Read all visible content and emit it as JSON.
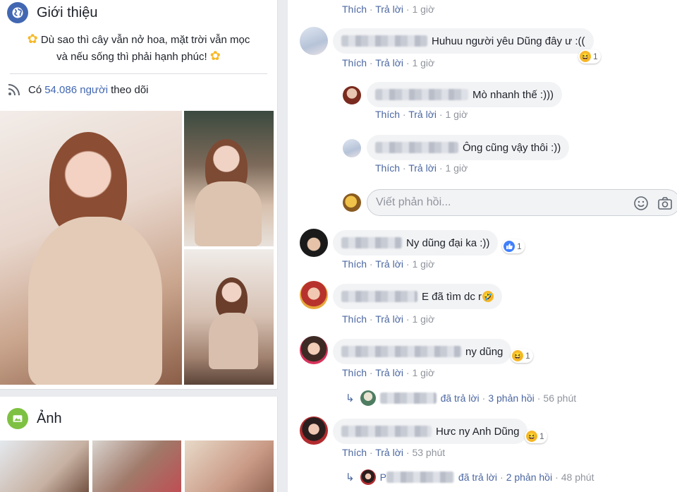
{
  "intro": {
    "title": "Giới thiệu",
    "bio_line1": "Dù sao thì cây vẫn nở hoa, mặt trời vẫn mọc",
    "bio_line2": "và nếu sống thì phải hạnh phúc!",
    "follow_prefix": "Có",
    "follow_count": "54.086 người",
    "follow_suffix": "theo dõi"
  },
  "photos_card": {
    "title": "Ảnh"
  },
  "comments": [
    {
      "actions": {
        "like": "Thích",
        "reply": "Trả lời",
        "time": "1 giờ"
      }
    },
    {
      "text": "Huhuu người yêu Dũng đây ư :((",
      "react": "1",
      "actions": {
        "like": "Thích",
        "reply": "Trả lời",
        "time": "1 giờ"
      }
    },
    {
      "text": "Mò nhanh thế :)))",
      "actions": {
        "like": "Thích",
        "reply": "Trả lời",
        "time": "1 giờ"
      }
    },
    {
      "text": "Ông cũng vậy thôi :))",
      "actions": {
        "like": "Thích",
        "reply": "Trả lời",
        "time": "1 giờ"
      }
    },
    {
      "text": "Ny dũng đại ka :))",
      "react": "1",
      "actions": {
        "like": "Thích",
        "reply": "Trả lời",
        "time": "1 giờ"
      }
    },
    {
      "text": "E đã tìm dc r",
      "actions": {
        "like": "Thích",
        "reply": "Trả lời",
        "time": "1 giờ"
      }
    },
    {
      "text": "ny dũng",
      "react": "1",
      "actions": {
        "like": "Thích",
        "reply": "Trả lời",
        "time": "1 giờ"
      }
    },
    {
      "text": "Hưc ny Anh Dũng",
      "react": "1",
      "actions": {
        "like": "Thích",
        "reply": "Trả lời",
        "time": "53 phút"
      }
    }
  ],
  "reply_input": {
    "placeholder": "Viết phản hồi..."
  },
  "reply_summaries": [
    {
      "verb": "đã trả lời",
      "count": "3 phản hồi",
      "time": "56 phút"
    },
    {
      "initial": "P",
      "verb": "đã trả lời",
      "count": "2 phản hồi",
      "time": "48 phút"
    }
  ],
  "separator": "·",
  "colors": {
    "link": "#4b67a1",
    "accent": "#4267b2",
    "muted": "#90949c",
    "bubble": "#f2f3f5"
  },
  "icons": [
    "globe-icon",
    "rss-icon",
    "photo-icon",
    "smiley-icon",
    "camera-icon",
    "haha-emoji-icon",
    "like-reaction-icon",
    "reply-arrow-icon"
  ]
}
